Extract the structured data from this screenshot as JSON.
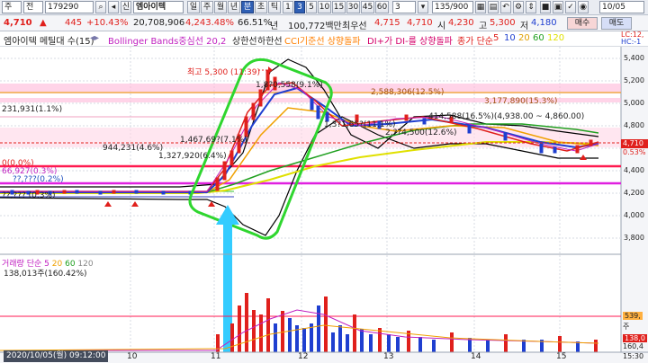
{
  "toolbar1": {
    "market": "주",
    "mode": "전",
    "code": "179290",
    "stock_name": "엠아이텍",
    "periods": [
      "일",
      "주",
      "월",
      "년",
      "분",
      "초",
      "틱"
    ],
    "minutes": [
      "1",
      "3",
      "5",
      "10",
      "15",
      "30",
      "45",
      "60"
    ],
    "interval_value": "3",
    "count": "135/900",
    "date": "10/05"
  },
  "toolbar2": {
    "price": "4,710",
    "change": "445",
    "change_pct": "+10.43%",
    "volume": "20,708,906",
    "amount_pct": "4,243.48%",
    "turnover": "66.51%",
    "unit": "년",
    "mktcap": "100,772백만",
    "best_sell_label": "최우선",
    "best_sell": "4,715",
    "best_buy": "4,710",
    "open_label": "시",
    "open": "4,230",
    "high_label": "고",
    "high": "5,300",
    "low_label": "저",
    "low": "4,180",
    "buy_btn": "매수",
    "sell_btn": "매도"
  },
  "legend": {
    "name": "엠아이텍 메틸대 수(15)",
    "bollinger": "Bollinger Bands중심선 20,2",
    "upper": "상한선",
    "lower": "하한선",
    "cci": "CCI기준선 상향돌파",
    "di": "DI+가 DI-를 상향돌파",
    "ma_label": "종가 단순",
    "ma_periods": [
      "5",
      "10",
      "20",
      "60",
      "120"
    ],
    "lc": "LC:12,",
    "hc": "HC:-1"
  },
  "price_axis": [
    "5,400",
    "5,200",
    "5,000",
    "4,800",
    "4,600",
    "4,400",
    "4,200",
    "4,000",
    "3,800"
  ],
  "current_price_tag": "4,710",
  "current_pct_tag": "0.53%",
  "annotations": {
    "high": "최고 5,300 (11:39)",
    "a1": "1,8?0,558(9.1%)",
    "a2": "2,588,306(12.5%)",
    "a3": "3,177,890(15.3%)",
    "a4": "231,931(1.1%)",
    "a5": "1,467,69?(7.1%)",
    "a6": "944,231(4.6%)",
    "a7": "1,327,920(6.4%)",
    "a8": "1,3?1,65?(11.1%)",
    "a9": "414,588(16.5%)(4,938.00 ~ 4,860.00)",
    "a10": "2,??4,500(12.6%)",
    "a11": "0(0.0%)",
    "a12": "66,927(0.3%)",
    "a13": "??,???(0.2%)",
    "a14": "??,??? (0.3%)"
  },
  "volume_panel": {
    "title": "거래량",
    "ma_label": "단순",
    "ma_periods": [
      "5",
      "20",
      "60",
      "120"
    ],
    "info": "138,013주(160.42%)",
    "axis_tag1": "539,",
    "axis_tag2": "138,0",
    "axis_tag3": "160,4",
    "axis_tag4": "주"
  },
  "x_axis": {
    "labels": [
      "10",
      "11",
      "12",
      "13",
      "14",
      "15"
    ],
    "time": "15:30",
    "cursor_date": "2020/10/05(월) 09:12:00"
  },
  "colors": {
    "up": "#e0201c",
    "down": "#1f3fd0",
    "highlight_box": "#2fd62f",
    "arrow": "#33ccff"
  }
}
